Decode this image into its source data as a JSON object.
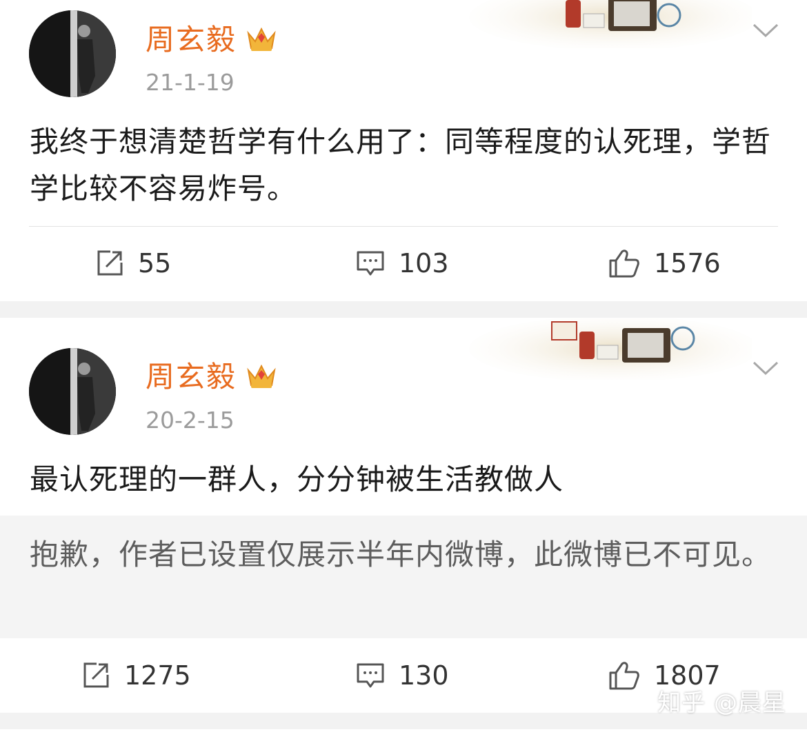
{
  "posts": [
    {
      "username": "周玄毅",
      "date": "21-1-19",
      "text": "我终于想清楚哲学有什么用了：同等程度的认死理，学哲学比较不容易炸号。",
      "repost_count": "55",
      "comment_count": "103",
      "like_count": "1576"
    },
    {
      "username": "周玄毅",
      "date": "20-2-15",
      "text": "最认死理的一群人，分分钟被生活教做人",
      "hidden_notice": "抱歉，作者已设置仅展示半年内微博，此微博已不可见。",
      "repost_count": "1275",
      "comment_count": "130",
      "like_count": "1807"
    }
  ],
  "watermark": "知乎 @晨星",
  "colors": {
    "username": "#e86b1f",
    "date": "#9b9b9b",
    "text": "#1a1a1a",
    "icon": "#555555",
    "background": "#f2f2f2"
  },
  "icons": {
    "repost": "share-square-icon",
    "comment": "comment-bubble-icon",
    "like": "thumbs-up-icon",
    "vip": "crown-icon",
    "menu": "chevron-down-icon"
  }
}
